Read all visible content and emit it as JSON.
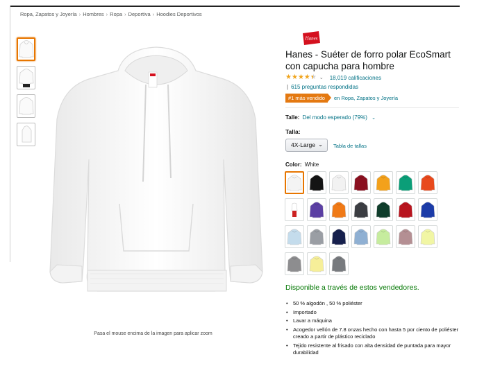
{
  "breadcrumb": [
    {
      "label": "Ropa, Zapatos y Joyería"
    },
    {
      "label": "Hombres"
    },
    {
      "label": "Ropa"
    },
    {
      "label": "Deportiva"
    },
    {
      "label": "Hoodies Deportivos"
    }
  ],
  "breadcrumb_separator": "›",
  "gallery": {
    "thumbnails": [
      {
        "icon": "hoodie-front-icon",
        "selected": true
      },
      {
        "icon": "hoodie-model-icon",
        "selected": false
      },
      {
        "icon": "hoodie-back-icon",
        "selected": false
      },
      {
        "icon": "hoodie-side-icon",
        "selected": false
      }
    ],
    "zoom_hint": "Pasa el mouse encima de la imagen para aplicar zoom"
  },
  "product": {
    "brand_logo_text": "Hanes",
    "title": "Hanes - Suéter de forro polar EcoSmart con capucha para hombre",
    "rating_stars": 4.5,
    "ratings_count": "18,019 calificaciones",
    "answered": "615 preguntas respondidas",
    "pipe": "|",
    "bestseller_badge": "#1 más vendido",
    "bestseller_category": "en Ropa, Zapatos y Joyería",
    "fit_label": "Talle:",
    "fit_value": "Del modo esperado (79%)",
    "size_label": "Talla:",
    "size_value": "4X-Large",
    "size_chart_link": "Tabla de tallas",
    "color_label": "Color:",
    "color_value": "White",
    "availability": "Disponible a través de estos vendedores.",
    "bullets": [
      "50 % algodón , 50 % poliéster",
      "Importado",
      "Lavar a máquina",
      "Acogedor vellón de 7.8 onzas hecho con hasta 5 por ciento de poliéster creado a partir de plástico reciclado",
      "Tejido resistente al frisado con alta densidad de puntada para mayor durabilidad"
    ]
  },
  "swatches": [
    {
      "color": "#f4f4f4",
      "selected": true
    },
    {
      "color": "#141414"
    },
    {
      "color": "#f2f2f2"
    },
    {
      "color": "#8a1020"
    },
    {
      "color": "#f3a11b"
    },
    {
      "color": "#0b9e78"
    },
    {
      "color": "#e8491c"
    },
    {
      "color": "#ffffff",
      "model": true
    },
    {
      "color": "#5b3fa3"
    },
    {
      "color": "#f07a17"
    },
    {
      "color": "#3b3d42"
    },
    {
      "color": "#0f3d2b"
    },
    {
      "color": "#b8141e"
    },
    {
      "color": "#1b3ba8"
    },
    {
      "color": "#c4dcec"
    },
    {
      "color": "#9a9ea4"
    },
    {
      "color": "#16204d"
    },
    {
      "color": "#8fb0d3"
    },
    {
      "color": "#c6ec9e"
    },
    {
      "color": "#b48f93"
    },
    {
      "color": "#f1f6a4"
    },
    {
      "color": "#8d8d8f"
    },
    {
      "color": "#f6ef99"
    },
    {
      "color": "#777a7e"
    }
  ],
  "colors": {
    "link": "#007185",
    "star": "#f0a41c",
    "badge": "#e47911",
    "availability": "#007600",
    "brand_red": "#d4101e"
  }
}
